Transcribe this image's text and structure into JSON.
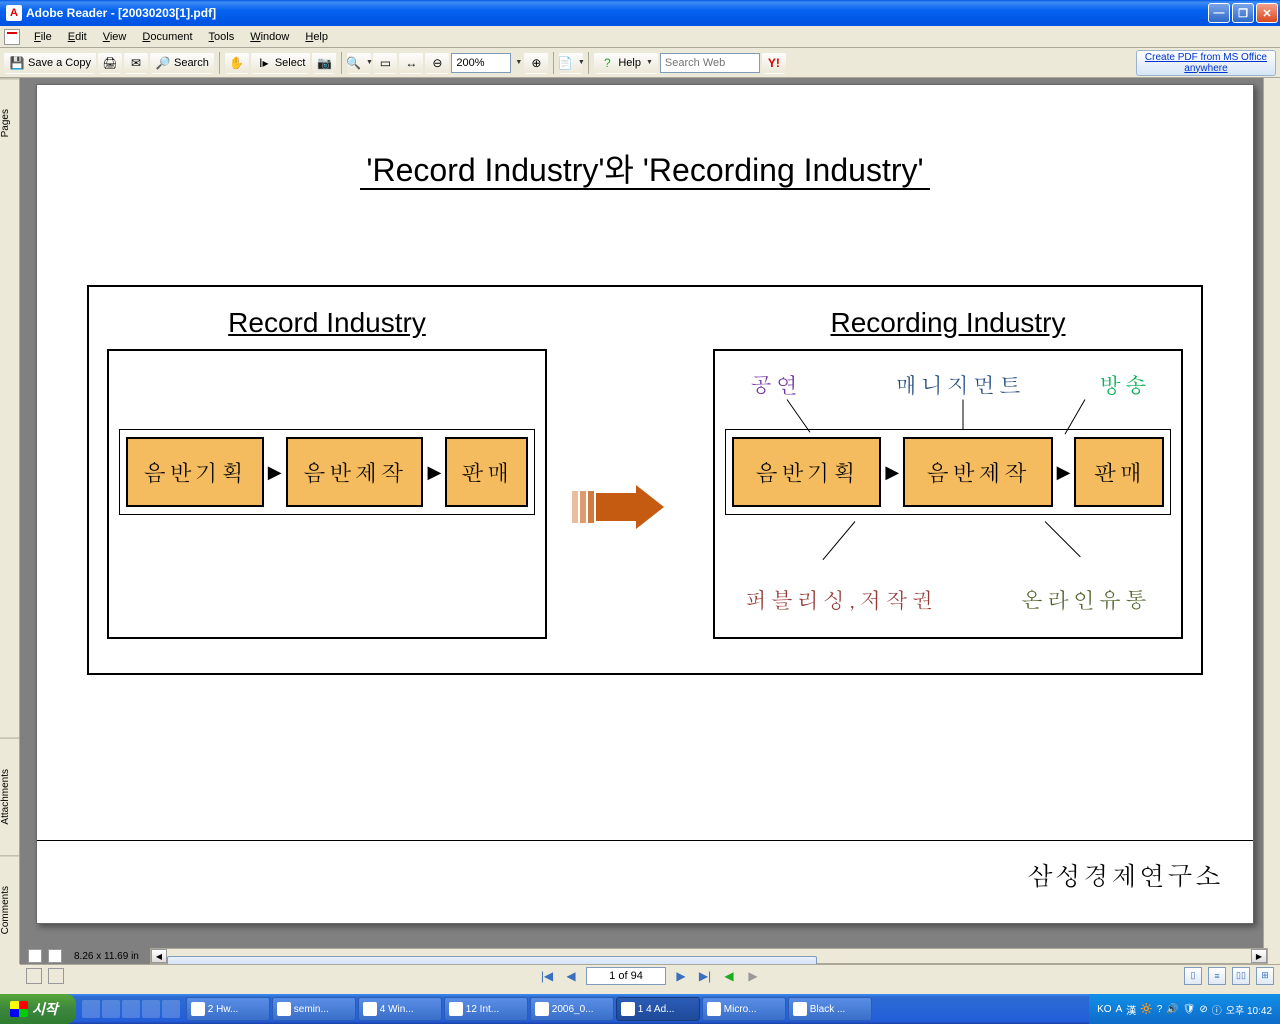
{
  "titlebar": {
    "app": "Adobe Reader",
    "doc": "[20030203[1].pdf]"
  },
  "menu": {
    "file": "File",
    "edit": "Edit",
    "view": "View",
    "document": "Document",
    "tools": "Tools",
    "window": "Window",
    "help": "Help"
  },
  "toolbar": {
    "save_copy": "Save a Copy",
    "search": "Search",
    "select": "Select",
    "zoom_value": "200%",
    "help": "Help",
    "search_placeholder": "Search Web",
    "promo_l1": "Create PDF from MS Office",
    "promo_l2": "anywhere"
  },
  "side_tabs": {
    "pages": "Pages",
    "attachments": "Attachments",
    "comments": "Comments"
  },
  "slide": {
    "title": "'Record Industry'와 'Recording Industry'",
    "left_heading": "Record Industry",
    "right_heading": "Recording Industry",
    "chain": {
      "b1": "음반기획",
      "b2": "음반제작",
      "b3": "판매"
    },
    "annotations": {
      "top1": "공연",
      "top2": "매니지먼트",
      "top3": "방송",
      "bot1": "퍼블리싱,저작권",
      "bot2": "온라인유통"
    },
    "footer": "삼성경제연구소"
  },
  "status": {
    "page_dims": "8.26 x 11.69 in",
    "page_of": "1 of 94"
  },
  "taskbar": {
    "start": "시작",
    "items": [
      {
        "label": "2 Hw..."
      },
      {
        "label": "semin..."
      },
      {
        "label": "4 Win..."
      },
      {
        "label": "12 Int..."
      },
      {
        "label": "2006_0..."
      },
      {
        "label": "1 4 Ad...",
        "active": true
      },
      {
        "label": "Micro..."
      },
      {
        "label": "Black ..."
      }
    ],
    "tray": {
      "lang": "KO",
      "ime1": "A",
      "ime2": "漢",
      "time": "오후 10:42"
    }
  }
}
